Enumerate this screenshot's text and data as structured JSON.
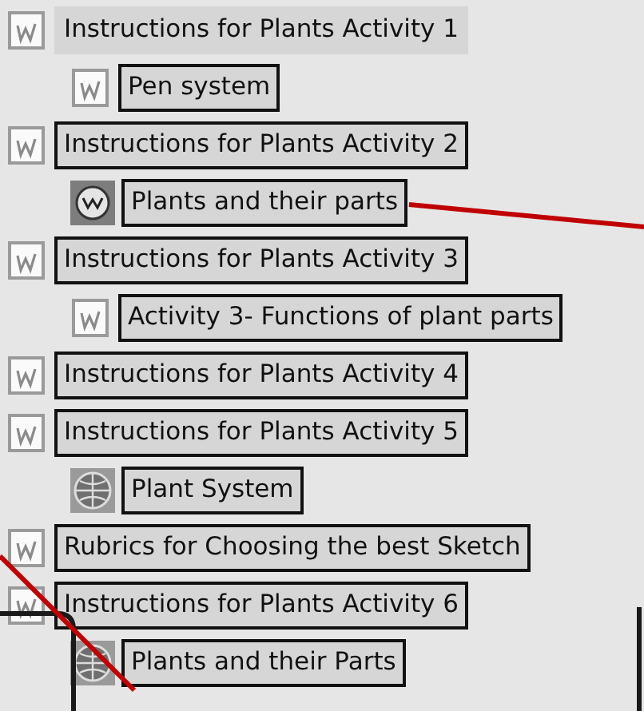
{
  "items": [
    {
      "kind": "document",
      "label": "Instructions for Plants Activity 1",
      "outlined": false,
      "children": [
        {
          "kind": "document",
          "label": "Pen system",
          "outlined": true
        }
      ]
    },
    {
      "kind": "document",
      "label": "Instructions for Plants Activity 2",
      "outlined": true,
      "children": [
        {
          "kind": "web",
          "label": "Plants and their parts",
          "outlined": true
        }
      ]
    },
    {
      "kind": "document",
      "label": "Instructions for Plants Activity 3",
      "outlined": true,
      "children": [
        {
          "kind": "document",
          "label": "Activity 3- Functions of plant parts",
          "outlined": true
        }
      ]
    },
    {
      "kind": "document",
      "label": "Instructions for Plants Activity 4",
      "outlined": true
    },
    {
      "kind": "document",
      "label": "Instructions for Plants Activity 5",
      "outlined": true,
      "children": [
        {
          "kind": "globe",
          "label": "Plant System",
          "outlined": true
        }
      ]
    },
    {
      "kind": "document",
      "label": "Rubrics for Choosing the best Sketch",
      "outlined": true
    },
    {
      "kind": "document",
      "label": "Instructions for Plants Activity 6",
      "outlined": true,
      "children": [
        {
          "kind": "globe",
          "label": "Plants and their Parts",
          "outlined": true
        }
      ]
    }
  ]
}
